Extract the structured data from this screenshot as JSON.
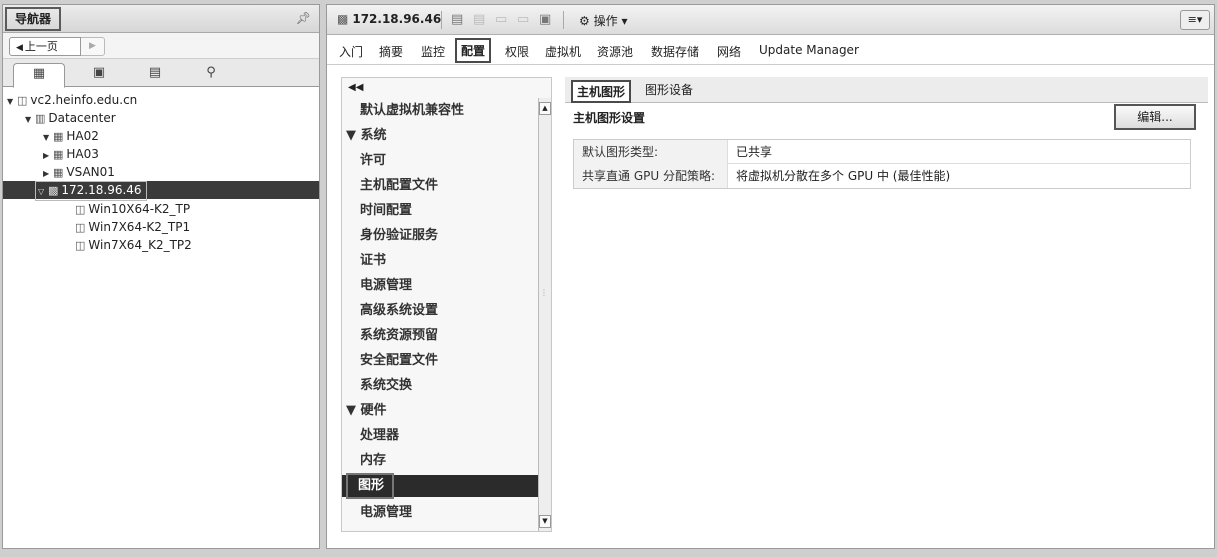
{
  "navigator": {
    "title": "导航器",
    "back_label": "上一页",
    "tree": [
      {
        "label": "vc2.heinfo.edu.cn"
      },
      {
        "label": "Datacenter"
      },
      {
        "label": "HA02"
      },
      {
        "label": "HA03"
      },
      {
        "label": "VSAN01"
      },
      {
        "label": "172.18.96.46"
      },
      {
        "label": "Win10X64-K2_TP"
      },
      {
        "label": "Win7X64-K2_TP1"
      },
      {
        "label": "Win7X64_K2_TP2"
      }
    ]
  },
  "toolbar": {
    "host": "172.18.96.46",
    "actions_label": "操作"
  },
  "tabs": [
    "入门",
    "摘要",
    "监控",
    "配置",
    "权限",
    "虚拟机",
    "资源池",
    "数据存储",
    "网络",
    "Update Manager"
  ],
  "settings": {
    "items": [
      {
        "label": "默认虚拟机兼容性",
        "kind": "item"
      },
      {
        "label": "系统",
        "kind": "group"
      },
      {
        "label": "许可",
        "kind": "item"
      },
      {
        "label": "主机配置文件",
        "kind": "item"
      },
      {
        "label": "时间配置",
        "kind": "item"
      },
      {
        "label": "身份验证服务",
        "kind": "item"
      },
      {
        "label": "证书",
        "kind": "item"
      },
      {
        "label": "电源管理",
        "kind": "item"
      },
      {
        "label": "高级系统设置",
        "kind": "item"
      },
      {
        "label": "系统资源预留",
        "kind": "item"
      },
      {
        "label": "安全配置文件",
        "kind": "item"
      },
      {
        "label": "系统交换",
        "kind": "item"
      },
      {
        "label": "硬件",
        "kind": "group"
      },
      {
        "label": "处理器",
        "kind": "item"
      },
      {
        "label": "内存",
        "kind": "item"
      },
      {
        "label": "图形",
        "kind": "item"
      },
      {
        "label": "电源管理",
        "kind": "item"
      }
    ]
  },
  "detail": {
    "tabs": [
      "主机图形",
      "图形设备"
    ],
    "section_title": "主机图形设置",
    "edit_label": "编辑...",
    "rows": [
      {
        "key": "默认图形类型:",
        "value": "已共享"
      },
      {
        "key": "共享直通 GPU 分配策略:",
        "value": "将虚拟机分散在多个 GPU 中 (最佳性能)"
      }
    ]
  }
}
